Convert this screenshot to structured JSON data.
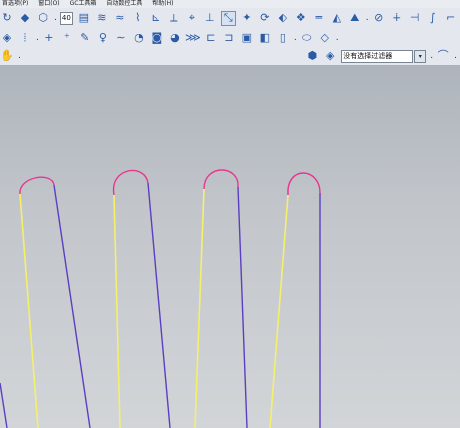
{
  "menu": {
    "items": [
      "首选项(P)",
      "窗口(O)",
      "GC工具箱",
      "自动数控工具",
      "帮助(H)"
    ]
  },
  "toolbar1": {
    "value_field": "40",
    "icons": [
      "rotate-icon",
      "solid-cube-icon",
      "wire-cube-icon",
      "sheet-icon",
      "curve-icon",
      "curve2-icon",
      "curve3-icon",
      "plane-icon",
      "axis-icon",
      "datum-icon",
      "point-icon",
      "measure-icon",
      "analysis-icon",
      "sync-icon",
      "layer-icon",
      "blend-icon",
      "render-icon",
      "grid-icon",
      "line-icon",
      "arc-icon",
      "corner-icon"
    ]
  },
  "toolbar2": {
    "icons": [
      "snap-icon",
      "point-constructor-icon",
      "plus-icon",
      "point-set-icon",
      "pencil-icon",
      "spline-icon",
      "wave-icon",
      "offset-icon",
      "project-icon",
      "bridge-icon",
      "extend-icon",
      "trim-icon",
      "divide-icon",
      "edit-curve-icon",
      "analyze-icon"
    ]
  },
  "toolbar3": {
    "filter_value": "没有选择过滤器",
    "icons": [
      "hand-icon",
      "select-icon",
      "filter-icon",
      "dropdown-icon",
      "wave-icon"
    ]
  },
  "colors": {
    "yellow_curve": "#f5f06a",
    "purple_curve": "#5a3fc2",
    "magenta_arc": "#e8368f",
    "viewport_top": "#aeb4bb"
  }
}
